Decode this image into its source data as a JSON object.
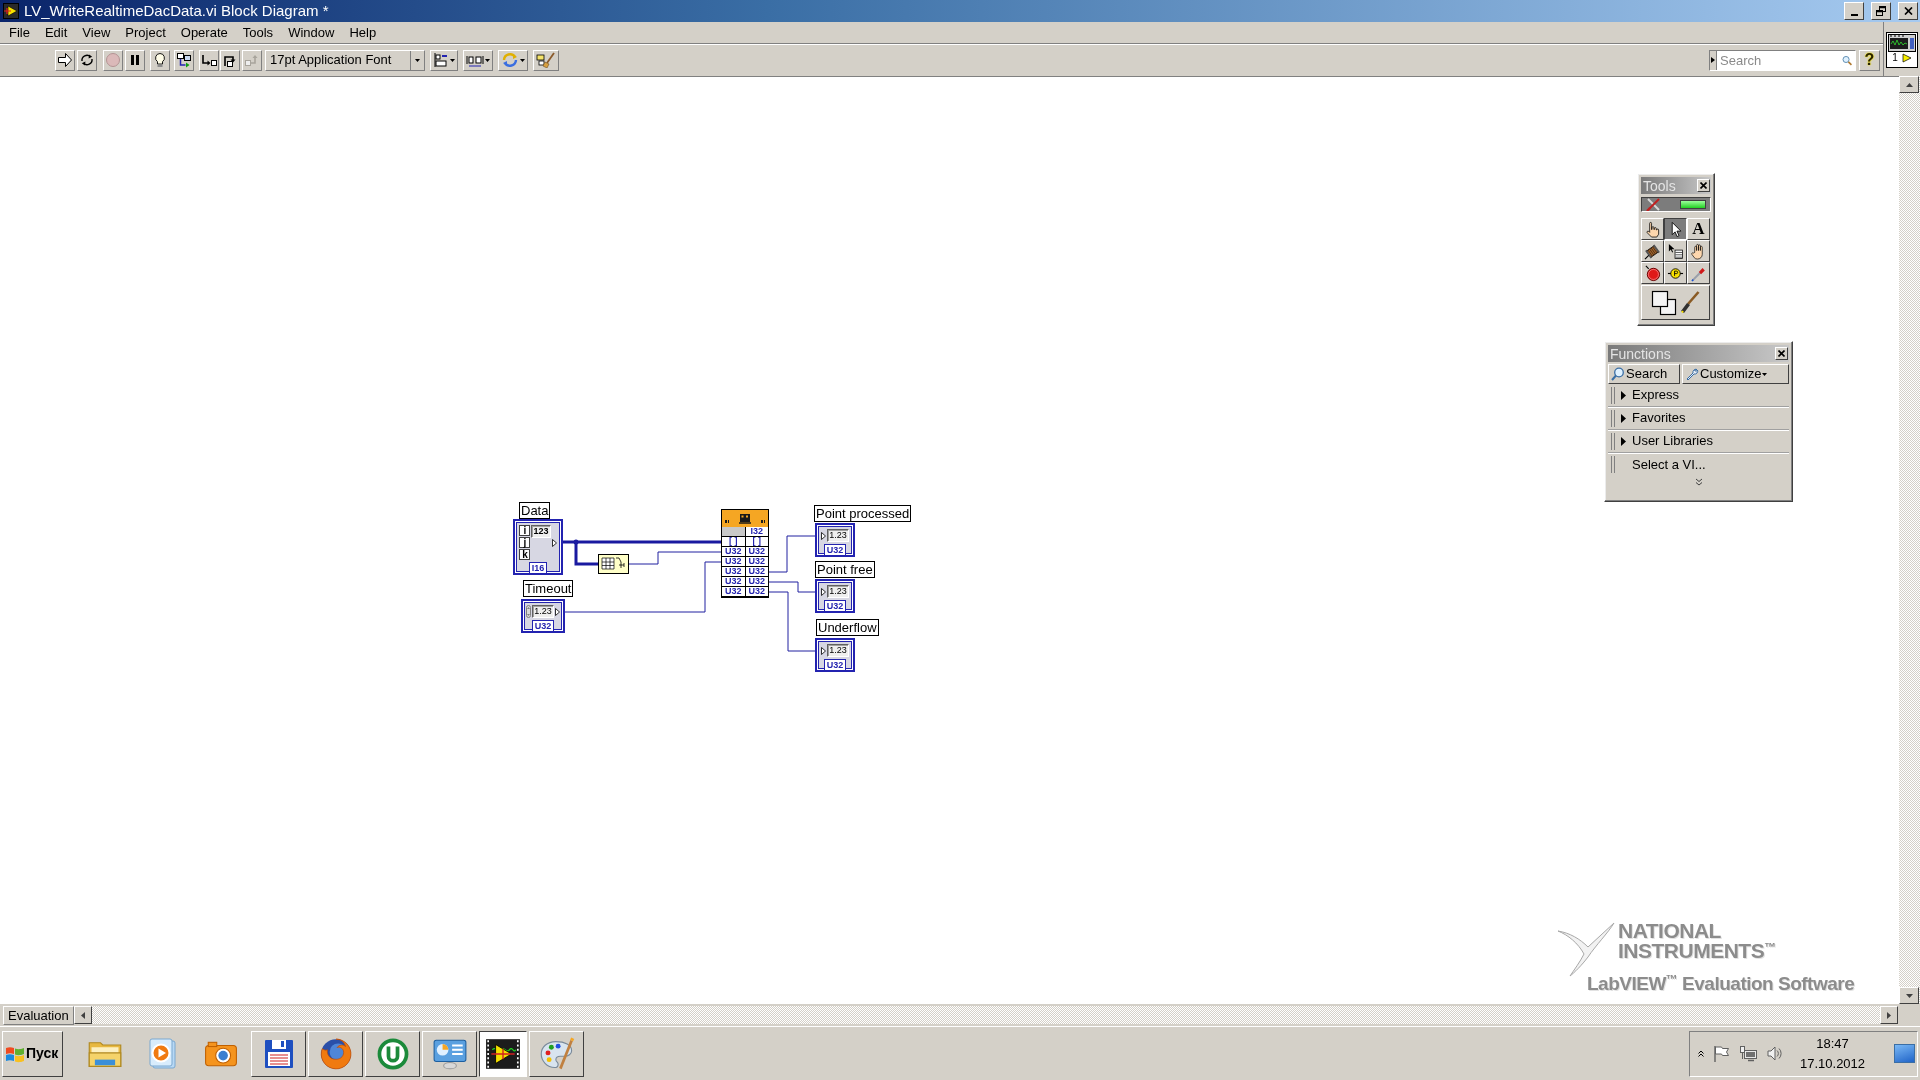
{
  "window": {
    "title": "LV_WriteRealtimeDacData.vi Block Diagram *"
  },
  "menu": [
    "File",
    "Edit",
    "View",
    "Project",
    "Operate",
    "Tools",
    "Window",
    "Help"
  ],
  "toolbar": {
    "execution": [
      {
        "kind": "run",
        "disabled": false
      },
      {
        "kind": "run-continuously",
        "disabled": false
      },
      {
        "kind": "abort",
        "disabled": true
      },
      {
        "kind": "pause",
        "disabled": false
      },
      {
        "kind": "highlight",
        "disabled": false
      },
      {
        "kind": "retain",
        "disabled": false
      },
      {
        "kind": "step-into",
        "disabled": false
      },
      {
        "kind": "step-over",
        "disabled": false
      },
      {
        "kind": "step-out",
        "disabled": true
      }
    ],
    "font": "17pt Application Font",
    "layout": [
      {
        "kind": "align"
      },
      {
        "kind": "distribute"
      },
      {
        "kind": "reorder"
      },
      {
        "kind": "cleanup"
      }
    ],
    "search": {
      "placeholder": "Search"
    },
    "help": "?"
  },
  "vi_icon": {
    "number": "1"
  },
  "diagram": {
    "controls": [
      {
        "label": "Data",
        "kind": "array",
        "indices": [
          "i",
          "j",
          "k"
        ],
        "display": "123",
        "type": "I16"
      },
      {
        "label": "Timeout",
        "kind": "numeric",
        "display": "1.23",
        "type": "U32"
      }
    ],
    "node": {
      "rows": [
        {
          "right": "I32"
        },
        {
          "left": "[ ]",
          "right": "[ ]"
        },
        {
          "left": "U32",
          "right": "U32"
        },
        {
          "left": "U32",
          "right": "U32"
        },
        {
          "left": "U32",
          "right": "U32"
        },
        {
          "left": "U32",
          "right": "U32"
        },
        {
          "left": "U32",
          "right": "U32"
        }
      ]
    },
    "indicators": [
      {
        "label": "Point processed",
        "display": "1.23",
        "type": "U32"
      },
      {
        "label": "Point free",
        "display": "1.23",
        "type": "U32"
      },
      {
        "label": "Underflow",
        "display": "1.23",
        "type": "U32"
      }
    ]
  },
  "tools_palette": {
    "title": "Tools",
    "auto_tool": {
      "on": true
    },
    "tools": [
      {
        "kind": "operate",
        "selected": false
      },
      {
        "kind": "position",
        "selected": true
      },
      {
        "kind": "label",
        "glyph": "A",
        "selected": false
      },
      {
        "kind": "wiring",
        "selected": false
      },
      {
        "kind": "shortcut",
        "selected": false
      },
      {
        "kind": "scroll",
        "selected": false
      },
      {
        "kind": "breakpoint",
        "selected": false
      },
      {
        "kind": "probe",
        "selected": false
      },
      {
        "kind": "color-copy",
        "selected": false
      },
      {
        "kind": "coloring",
        "selected": false
      }
    ]
  },
  "functions_palette": {
    "title": "Functions",
    "buttons": [
      {
        "kind": "search",
        "label": "Search"
      },
      {
        "kind": "customize",
        "label": "Customize"
      }
    ],
    "items": [
      {
        "label": "Express",
        "kind": "category"
      },
      {
        "label": "Favorites",
        "kind": "category"
      },
      {
        "label": "User Libraries",
        "kind": "category"
      },
      {
        "label": "Select a VI...",
        "kind": "action"
      }
    ]
  },
  "watermark": {
    "brand": [
      "NATIONAL",
      "INSTRUMENTS$^{™}$"
    ],
    "product": "LabVIEW$^{™}$ Evaluation Software"
  },
  "status_bar": {
    "label": "Evaluation"
  },
  "taskbar": {
    "start": "Пуск",
    "apps": [
      {
        "kind": "explorer",
        "running": false,
        "selected": false
      },
      {
        "kind": "media-player",
        "running": false,
        "selected": false
      },
      {
        "kind": "camera",
        "running": false,
        "selected": false
      },
      {
        "kind": "floppy",
        "running": true,
        "selected": false
      },
      {
        "kind": "firefox",
        "running": true,
        "selected": false
      },
      {
        "kind": "utorrent",
        "running": true,
        "selected": false
      },
      {
        "kind": "control-panel",
        "running": true,
        "selected": false
      },
      {
        "kind": "labview",
        "running": true,
        "selected": true
      },
      {
        "kind": "paint",
        "running": true,
        "selected": false
      }
    ],
    "clock": {
      "time": "18:47",
      "date": "17.10.2012"
    }
  }
}
